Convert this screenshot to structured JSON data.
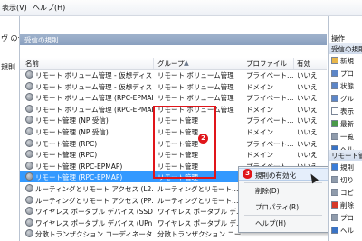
{
  "menubar": {
    "items": [
      "表示(V)",
      "ヘルプ(H)"
    ]
  },
  "left_pane": {
    "lines": [
      "ヴ のセ",
      "",
      "規則"
    ]
  },
  "center": {
    "title": "受信の規則",
    "columns": {
      "name": "名前",
      "group": "グループ",
      "profile": "プロファイル",
      "enabled": "有効"
    },
    "rows": [
      {
        "name": "リモート ボリューム管理 - 仮想ディス…",
        "group": "リモート ボリューム管理",
        "profile": "プライベート…",
        "enabled": "いいえ"
      },
      {
        "name": "リモート ボリューム管理 - 仮想ディス…",
        "group": "リモート ボリューム管理",
        "profile": "ドメイン",
        "enabled": "いいえ"
      },
      {
        "name": "リモート ボリューム管理 (RPC-EPMAP)",
        "group": "リモート ボリューム管理",
        "profile": "プライベート…",
        "enabled": "いいえ"
      },
      {
        "name": "リモート ボリューム管理 (RPC-EPMAP)",
        "group": "リモート ボリューム管理",
        "profile": "ドメイン",
        "enabled": "いいえ"
      },
      {
        "name": "リモート管理 (NP 受信)",
        "group": "リモート管理",
        "profile": "プライベート…",
        "enabled": "いいえ"
      },
      {
        "name": "リモート管理 (NP 受信)",
        "group": "リモート管理",
        "profile": "ドメイン",
        "enabled": "いいえ"
      },
      {
        "name": "リモート管理 (RPC)",
        "group": "リモート管理",
        "profile": "プライベート…",
        "enabled": "いいえ"
      },
      {
        "name": "リモート管理 (RPC)",
        "group": "リモート管理",
        "profile": "ドメイン",
        "enabled": "いいえ"
      },
      {
        "name": "リモート管理 (RPC-EPMAP)",
        "group": "リモート管理",
        "profile": "プライベート…",
        "enabled": "いいえ"
      },
      {
        "name": "リモート管理 (RPC-EPMAP)",
        "group": "リモート管理",
        "profile": "ドメイン",
        "enabled": "いいえ"
      },
      {
        "name": "ルーティングとリモート アクセス (L2…",
        "group": "ルーティングとリモート…",
        "profile": "",
        "enabled": ""
      },
      {
        "name": "ルーティングとリモート アクセス (PP…",
        "group": "ルーティングとリモート…",
        "profile": "",
        "enabled": ""
      },
      {
        "name": "ワイヤレス ポータブル デバイス (SSD…",
        "group": "ワイヤレス ポータブル デ…",
        "profile": "",
        "enabled": ""
      },
      {
        "name": "ワイヤレス ポータブル デバイス (UPn…",
        "group": "ワイヤレス ポータブル デ…",
        "profile": "",
        "enabled": ""
      },
      {
        "name": "分散トランザクション コーディネータ…",
        "group": "分散トランザクション コー…",
        "profile": "",
        "enabled": ""
      }
    ],
    "selected_row": 9,
    "badge_2": "2",
    "badge_3": "3"
  },
  "context_menu": {
    "items": [
      "規則の有効化",
      "削除(D)",
      "プロパティ(R)",
      "ヘルプ(H)"
    ]
  },
  "actions": {
    "title": "操作",
    "group1": "受信の規則",
    "items1": [
      {
        "label": "新規",
        "icon": "new-rule-icon",
        "color": "#e8b64a"
      },
      {
        "label": "プロ",
        "icon": "filter-icon",
        "color": "#5d86c7"
      },
      {
        "label": "状態",
        "icon": "filter-icon",
        "color": "#5d86c7"
      },
      {
        "label": "グル",
        "icon": "filter-icon",
        "color": "#5d86c7"
      },
      {
        "label": "表示",
        "icon": "view-icon",
        "color": "#ffffff"
      },
      {
        "label": "最新",
        "icon": "refresh-icon",
        "color": "#4a9a4a"
      },
      {
        "label": "一覧",
        "icon": "export-icon",
        "color": "#8f9bab"
      },
      {
        "label": "ヘル",
        "icon": "help-icon",
        "color": "#3a73c4"
      }
    ],
    "group2": "リモート管",
    "items2": [
      {
        "label": "規則",
        "icon": "enable-icon",
        "color": "#3a7dd8"
      },
      {
        "label": "切り",
        "icon": "cut-icon",
        "color": "#8f9bab"
      },
      {
        "label": "コピ",
        "icon": "copy-icon",
        "color": "#8f9bab"
      },
      {
        "label": "削除",
        "icon": "delete-icon",
        "color": "#d63a2a"
      },
      {
        "label": "プロ",
        "icon": "properties-icon",
        "color": "#8f9bab"
      },
      {
        "label": "ヘル",
        "icon": "help-icon",
        "color": "#3a73c4"
      }
    ]
  }
}
